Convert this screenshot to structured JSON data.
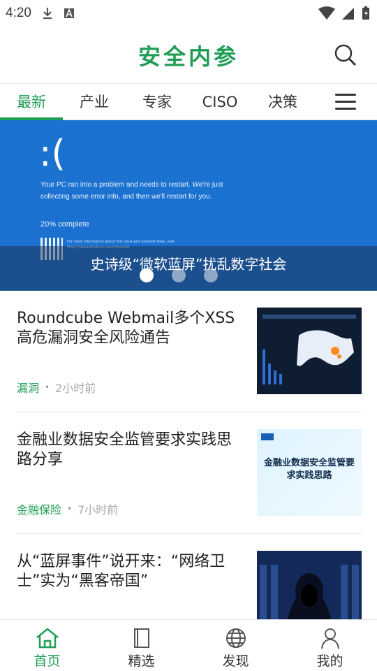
{
  "status": {
    "time": "4:20"
  },
  "header": {
    "title": "安全内参"
  },
  "tabs": [
    "最新",
    "产业",
    "专家",
    "CISO",
    "决策"
  ],
  "banner": {
    "face": ":(",
    "text": "Your PC ran into a problem and needs to restart. We're just collecting some error info, and then we'll restart for you.",
    "percent": "20% complete",
    "small": "For more information about this issue and possible fixes, visit https://www.windows.com/stopcode",
    "caption": "史诗级“微软蓝屏”扰乱数字社会"
  },
  "articles": [
    {
      "title": "Roundcube Webmail多个XSS高危漏洞安全风险通告",
      "tag": "漏洞",
      "time": "2小时前"
    },
    {
      "title": "金融业数据安全监管要求实践思路分享",
      "tag": "金融保险",
      "time": "7小时前",
      "thumb_text": "金融业数据安全监管要求实践思路"
    },
    {
      "title": "从“蓝屏事件”说开来：“网络卫士”实为“黑客帝国”",
      "tag": "",
      "time": ""
    }
  ],
  "tabbar": [
    "首页",
    "精选",
    "发现",
    "我的"
  ],
  "colors": {
    "accent": "#1f9d55",
    "banner": "#1b6fcf"
  }
}
